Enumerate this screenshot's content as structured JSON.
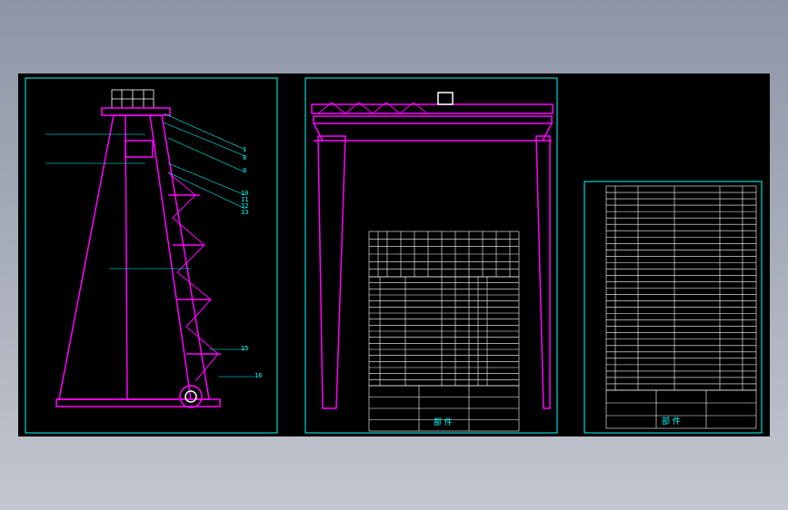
{
  "colors": {
    "background_top": "#8e95a5",
    "background_bottom": "#c2c6cf",
    "canvas": "#000000",
    "border": "#00ffff",
    "structure": "#ff00ff",
    "table": "#ffffff"
  },
  "sheet1": {
    "callouts": [
      "1",
      "8",
      "9",
      "10",
      "11",
      "12",
      "13",
      "15",
      "16"
    ]
  },
  "sheet2": {
    "title_block": {
      "name": "部 件"
    }
  },
  "sheet3": {
    "title_block": {
      "name": "部 件"
    }
  }
}
